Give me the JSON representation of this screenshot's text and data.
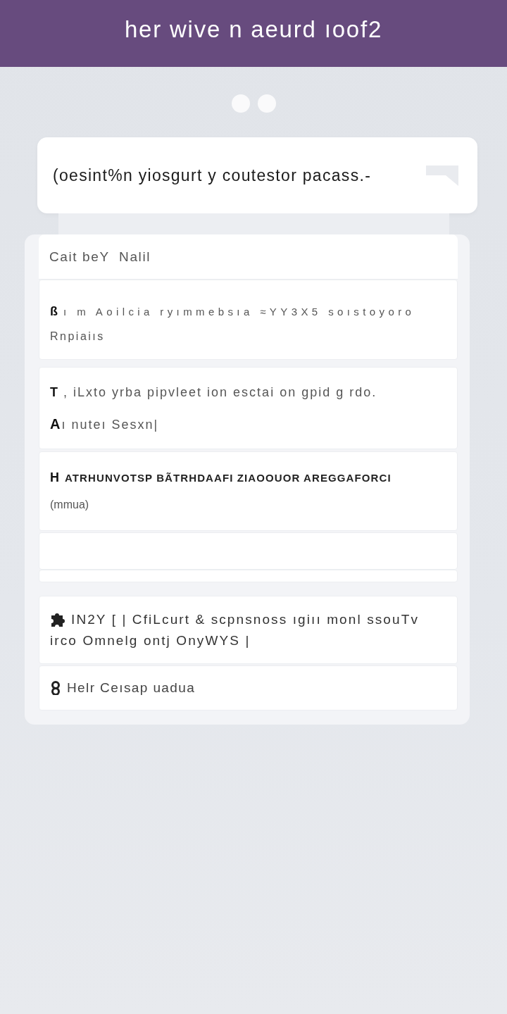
{
  "header": {
    "title": "her wive n aeurd ıoof2"
  },
  "prompt_card": {
    "text": "(oesint%n yiosgurt y coutestor pacass.-"
  },
  "list": {
    "header": "Cait beY  Nalil",
    "items": [
      {
        "kind": "glyph",
        "glyph": "ß",
        "lines": [
          "ı m Aoilcia ryımmebsıa ≈YY3X5 soıstoyoro",
          "Rnpiaiıs"
        ]
      },
      {
        "kind": "glyph",
        "glyph": "T",
        "lines": [
          ", iLxto yrba pipvleet ion esctai on gpid  g rdo.",
          "**A**ı nuteı Sesxn|"
        ]
      },
      {
        "kind": "glyph",
        "glyph": "H",
        "lines": [
          "ATRHUNVOTSP BÃTRHDAAFI ZIAOOUOR AREGGAFORCI",
          "(mmua)"
        ]
      },
      {
        "kind": "blank"
      },
      {
        "kind": "blank"
      }
    ]
  },
  "more_items": [
    {
      "kind": "puzzle",
      "lines": [
        "IN2Y [ | CfiLcurt & scpnsnoss ıgiıı monl ssouTv",
        "irco Omnelg  ontj OnyWYS |"
      ]
    },
    {
      "kind": "loop",
      "lines": [
        "Helr Ceısap uadua"
      ]
    }
  ]
}
